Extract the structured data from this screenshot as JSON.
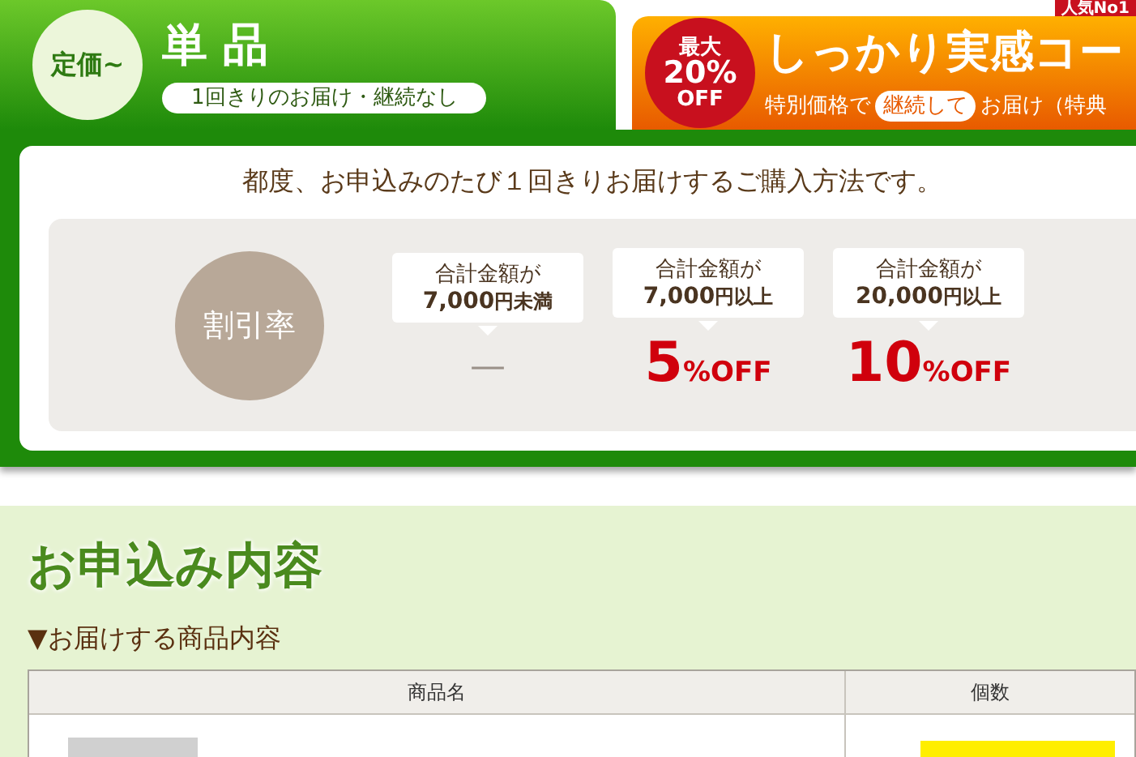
{
  "plan_tabs": [
    {
      "kind": "single",
      "badge": "定価~",
      "title": "単 品",
      "subtitle_parts": [
        {
          "text": "1回きりのお届け・継続なし",
          "highlight": true
        }
      ],
      "selected": true
    },
    {
      "kind": "course",
      "corner_label": "人気No1",
      "badge_lines": [
        "最大",
        "20%",
        "OFF"
      ],
      "title": "しっかり実感コー",
      "subtitle_parts": [
        {
          "text": "特別価格で",
          "highlight": false
        },
        {
          "text": "継続して",
          "highlight": true
        },
        {
          "text": "お届け（特典",
          "highlight": false
        }
      ],
      "selected": false
    }
  ],
  "description": "都度、お申込みのたび１回きりお届けするご購入方法です。",
  "discount": {
    "label": "割引率",
    "tiers": [
      {
        "kind": "none",
        "condition_top": "合計金額が",
        "amount": "7,000",
        "amount_suffix": "円未満",
        "rate": "—"
      },
      {
        "kind": "off",
        "condition_top": "合計金額が",
        "amount": "7,000",
        "amount_suffix": "円以上",
        "rate": "5",
        "rate_unit": "%OFF"
      },
      {
        "kind": "off",
        "condition_top": "合計金額が",
        "amount": "20,000",
        "amount_suffix": "円以上",
        "rate": "10",
        "rate_unit": "%OFF"
      }
    ]
  },
  "order": {
    "heading": "お申込み内容",
    "subheading": "▼お届けする商品内容",
    "table": {
      "columns": [
        "商品名",
        "個数"
      ]
    }
  }
}
